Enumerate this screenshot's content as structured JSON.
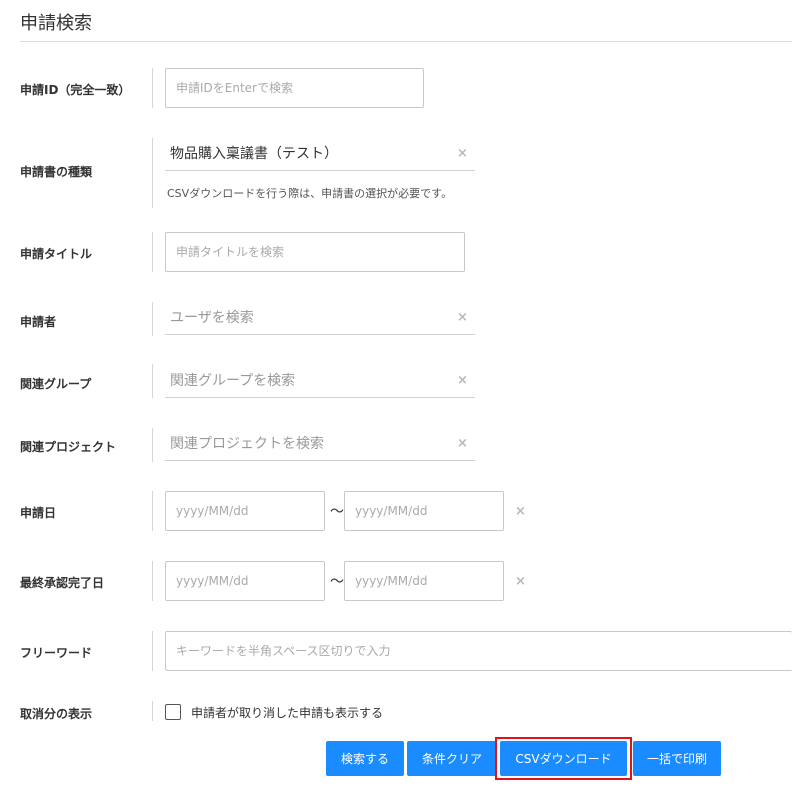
{
  "page": {
    "title": "申請検索"
  },
  "form": {
    "request_id": {
      "label": "申請ID（完全一致）",
      "placeholder": "申請IDをEnterで検索"
    },
    "form_type": {
      "label": "申請書の種類",
      "value": "物品購入稟議書（テスト）",
      "help": "CSVダウンロードを行う際は、申請書の選択が必要です。"
    },
    "request_title": {
      "label": "申請タイトル",
      "placeholder": "申請タイトルを検索"
    },
    "applicant": {
      "label": "申請者",
      "placeholder": "ユーザを検索"
    },
    "related_group": {
      "label": "関連グループ",
      "placeholder": "関連グループを検索"
    },
    "related_project": {
      "label": "関連プロジェクト",
      "placeholder": "関連プロジェクトを検索"
    },
    "request_date": {
      "label": "申請日",
      "from_placeholder": "yyyy/MM/dd",
      "to_placeholder": "yyyy/MM/dd",
      "separator": "〜"
    },
    "final_approval_date": {
      "label": "最終承認完了日",
      "from_placeholder": "yyyy/MM/dd",
      "to_placeholder": "yyyy/MM/dd",
      "separator": "〜"
    },
    "free_word": {
      "label": "フリーワード",
      "placeholder": "キーワードを半角スペース区切りで入力"
    },
    "show_cancelled": {
      "label": "取消分の表示",
      "checkbox_label": "申請者が取り消した申請も表示する",
      "checked": false
    }
  },
  "buttons": {
    "search": "検索する",
    "clear": "条件クリア",
    "csv": "CSVダウンロード",
    "print": "一括で印刷"
  },
  "icons": {
    "clear": "close-icon",
    "checkbox": "checkbox-icon"
  },
  "colors": {
    "primary": "#1a8cff",
    "highlight": "#e0121c"
  }
}
